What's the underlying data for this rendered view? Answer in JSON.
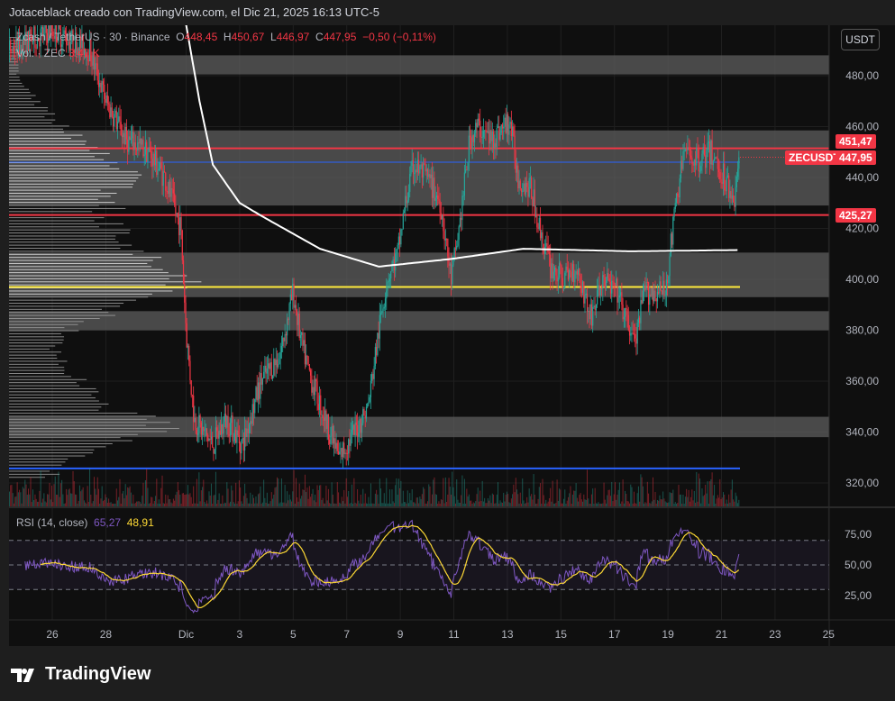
{
  "header": {
    "title": "Jotaceblack creado con TradingView.com, el Dic 21, 2025 16:13 UTC-5"
  },
  "legend": {
    "symbol": "Zcash / TetherUS · 30 · Binance",
    "o_label": "O",
    "o": "448,45",
    "h_label": "H",
    "h": "450,67",
    "l_label": "L",
    "l": "446,97",
    "c_label": "C",
    "c": "447,95",
    "change": "−0,50 (−0,11%)",
    "vol_label": "Vol. · ZEC",
    "vol": "3,47 K"
  },
  "rsi_legend": {
    "label": "RSI (14, close)",
    "rsi": "65,27",
    "ma": "48,91"
  },
  "currency_button": "USDT",
  "price_tags": {
    "line_upper": "451,47",
    "symbol": "ZECUSDT",
    "last": "447,95",
    "line_lower": "425,27"
  },
  "footer": {
    "brand": "TradingView"
  },
  "colors": {
    "up": "#26a69a",
    "down": "#f23645",
    "ma": "#ffffff",
    "rsi": "#7e57c2",
    "rsi_ma": "#fdd835",
    "hline_red": "#f23645",
    "hline_blue": "#2962ff",
    "hline_yellow": "#ffeb3b"
  },
  "chart_data": {
    "type": "candlestick",
    "title": "Zcash / TetherUS · 30 · Binance",
    "x_unit": "days since Nov 26, 2025",
    "ylim": [
      310,
      500
    ],
    "y_ticks": [
      "480,00",
      "460,00",
      "440,00",
      "420,00",
      "400,00",
      "380,00",
      "360,00",
      "340,00",
      "320,00"
    ],
    "y_tick_values": [
      480,
      460,
      440,
      420,
      400,
      380,
      360,
      340,
      320
    ],
    "x_ticks": [
      {
        "day": 0,
        "label": "26"
      },
      {
        "day": 2,
        "label": "28"
      },
      {
        "day": 5,
        "label": "Dic"
      },
      {
        "day": 7,
        "label": "3"
      },
      {
        "day": 9,
        "label": "5"
      },
      {
        "day": 11,
        "label": "7"
      },
      {
        "day": 13,
        "label": "9"
      },
      {
        "day": 15,
        "label": "11"
      },
      {
        "day": 17,
        "label": "13"
      },
      {
        "day": 19,
        "label": "15"
      },
      {
        "day": 21,
        "label": "17"
      },
      {
        "day": 23,
        "label": "19"
      },
      {
        "day": 25,
        "label": "21"
      },
      {
        "day": 27,
        "label": "23"
      },
      {
        "day": 29,
        "label": "25"
      }
    ],
    "price_path": [
      [
        -1.6,
        490
      ],
      [
        0,
        498
      ],
      [
        1.4,
        490
      ],
      [
        2,
        470
      ],
      [
        2.75,
        455
      ],
      [
        3.6,
        450
      ],
      [
        4.2,
        440
      ],
      [
        4.8,
        420
      ],
      [
        5.0,
        380
      ],
      [
        5.3,
        345
      ],
      [
        6.0,
        335
      ],
      [
        6.5,
        345
      ],
      [
        7.1,
        335
      ],
      [
        7.8,
        360
      ],
      [
        8.5,
        370
      ],
      [
        9.0,
        395
      ],
      [
        9.3,
        375
      ],
      [
        9.7,
        360
      ],
      [
        10.2,
        345
      ],
      [
        10.7,
        330
      ],
      [
        11.3,
        340
      ],
      [
        11.8,
        350
      ],
      [
        12.2,
        380
      ],
      [
        12.5,
        400
      ],
      [
        12.9,
        410
      ],
      [
        13.2,
        430
      ],
      [
        13.5,
        445
      ],
      [
        14.0,
        440
      ],
      [
        14.5,
        430
      ],
      [
        14.9,
        400
      ],
      [
        15.2,
        420
      ],
      [
        15.6,
        455
      ],
      [
        15.9,
        460
      ],
      [
        16.4,
        455
      ],
      [
        17.1,
        462
      ],
      [
        17.4,
        440
      ],
      [
        17.9,
        435
      ],
      [
        18.2,
        420
      ],
      [
        18.6,
        405
      ],
      [
        19.1,
        400
      ],
      [
        19.6,
        405
      ],
      [
        20.1,
        385
      ],
      [
        20.6,
        400
      ],
      [
        21.1,
        395
      ],
      [
        21.4,
        385
      ],
      [
        21.8,
        375
      ],
      [
        22.1,
        395
      ],
      [
        22.6,
        395
      ],
      [
        22.9,
        395
      ],
      [
        23.3,
        430
      ],
      [
        23.6,
        450
      ],
      [
        24.1,
        447
      ],
      [
        24.6,
        450
      ],
      [
        25.1,
        440
      ],
      [
        25.5,
        432
      ],
      [
        25.67,
        447.95
      ]
    ],
    "moving_average": [
      [
        5.0,
        500
      ],
      [
        5.5,
        470
      ],
      [
        6.0,
        445
      ],
      [
        7.0,
        430
      ],
      [
        7.8,
        425
      ],
      [
        10.0,
        412
      ],
      [
        12.2,
        405
      ],
      [
        14.9,
        408
      ],
      [
        17.6,
        412
      ],
      [
        21.6,
        411
      ],
      [
        25.67,
        411.5
      ]
    ],
    "zones": [
      [
        480.5,
        488
      ],
      [
        429,
        458.5
      ],
      [
        393,
        410.5
      ],
      [
        380,
        387.5
      ],
      [
        338,
        346
      ]
    ],
    "horizontal_lines": [
      {
        "price": 451.47,
        "color": "red"
      },
      {
        "price": 425.27,
        "color": "red"
      },
      {
        "price": 446,
        "color": "blue"
      },
      {
        "price": 397,
        "color": "yellow"
      },
      {
        "price": 325.7,
        "color": "blue"
      }
    ],
    "volume_profile": [
      [
        326,
        0.25
      ],
      [
        335,
        0.55
      ],
      [
        342,
        0.95
      ],
      [
        350,
        0.5
      ],
      [
        360,
        0.4
      ],
      [
        370,
        0.25
      ],
      [
        380,
        0.35
      ],
      [
        388,
        0.6
      ],
      [
        397,
        1.0
      ],
      [
        405,
        0.8
      ],
      [
        415,
        0.65
      ],
      [
        425,
        0.55
      ],
      [
        435,
        0.6
      ],
      [
        445,
        0.7
      ],
      [
        452,
        0.45
      ],
      [
        460,
        0.3
      ],
      [
        470,
        0.15
      ],
      [
        480,
        0.05
      ]
    ],
    "rsi": {
      "period": 14,
      "ylim": [
        10,
        90
      ],
      "levels": [
        70,
        50,
        30
      ],
      "ticks": [
        "75,00",
        "50,00",
        "25,00"
      ],
      "tick_values": [
        75,
        50,
        25
      ]
    }
  }
}
